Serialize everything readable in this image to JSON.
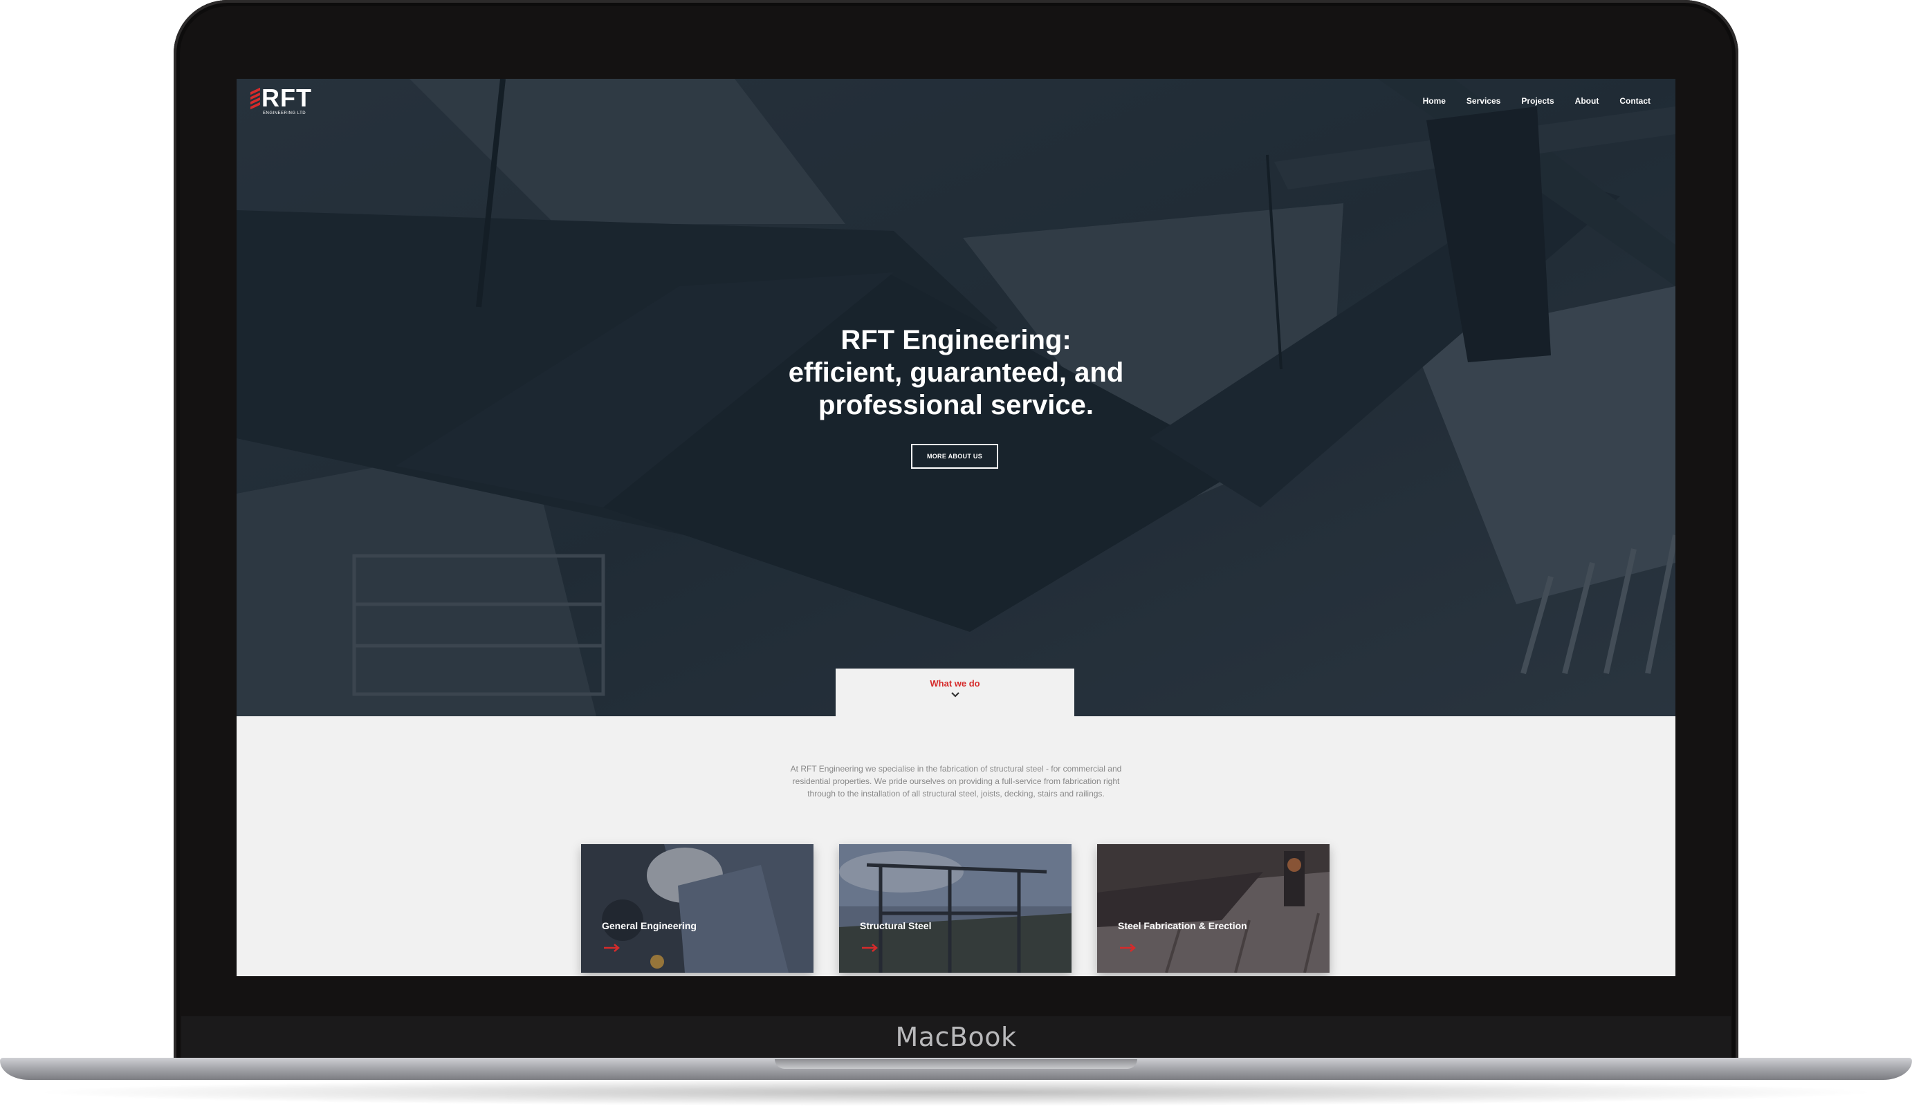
{
  "device": {
    "brand_label": "MacBook"
  },
  "site": {
    "logo_text": "RFT",
    "logo_subtext": "ENGINEERING LTD",
    "accent_color": "#d62b2b",
    "nav": [
      "Home",
      "Services",
      "Projects",
      "About",
      "Contact"
    ]
  },
  "hero": {
    "title_lines": [
      "RFT Engineering:",
      "efficient, guaranteed, and",
      "professional service."
    ],
    "button_label": "MORE ABOUT US",
    "background_overlay_color": "#1f2a35"
  },
  "what_we_do": {
    "label": "What we do",
    "chevron_icon": "chevron-down-icon",
    "intro_lines": [
      "At RFT Engineering we specialise in the fabrication of structural steel - for commercial and",
      "residential properties. We pride ourselves on providing a full-service from fabrication right",
      "through to the installation of all structural steel, joists, decking, stairs and railings."
    ]
  },
  "services": [
    {
      "title": "General Engineering",
      "icon": "arrow-right-icon"
    },
    {
      "title": "Structural Steel",
      "icon": "arrow-right-icon"
    },
    {
      "title": "Steel Fabrication & Erection",
      "icon": "arrow-right-icon"
    }
  ]
}
